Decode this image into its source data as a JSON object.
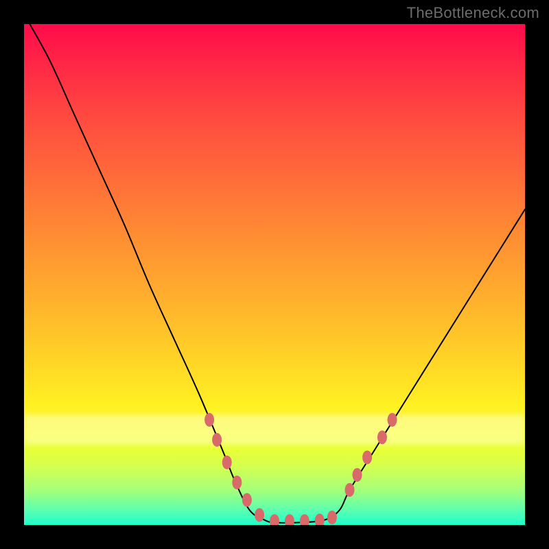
{
  "attribution": "TheBottleneck.com",
  "chart_data": {
    "type": "line",
    "title": "",
    "xlabel": "",
    "ylabel": "",
    "xlim": [
      0,
      100
    ],
    "ylim": [
      0,
      100
    ],
    "series": [
      {
        "name": "curve",
        "x": [
          0,
          5,
          10,
          15,
          20,
          25,
          30,
          35,
          40,
          42,
          45,
          48,
          50,
          55,
          60,
          63,
          65,
          70,
          75,
          80,
          85,
          90,
          95,
          100
        ],
        "values": [
          102,
          93,
          82,
          71,
          60,
          48,
          37,
          26,
          14,
          9,
          3,
          1,
          0.5,
          0.5,
          1,
          3,
          7,
          15,
          23,
          31,
          39,
          47,
          55,
          63
        ]
      }
    ],
    "markers": [
      {
        "x": 37,
        "y": 21
      },
      {
        "x": 38.5,
        "y": 17
      },
      {
        "x": 40.5,
        "y": 12.5
      },
      {
        "x": 42.5,
        "y": 8.5
      },
      {
        "x": 44.5,
        "y": 5
      },
      {
        "x": 47,
        "y": 2
      },
      {
        "x": 50,
        "y": 0.8
      },
      {
        "x": 53,
        "y": 0.8
      },
      {
        "x": 56,
        "y": 0.8
      },
      {
        "x": 59,
        "y": 0.9
      },
      {
        "x": 61.5,
        "y": 1.5
      },
      {
        "x": 65,
        "y": 7
      },
      {
        "x": 66.5,
        "y": 10
      },
      {
        "x": 68.5,
        "y": 13.5
      },
      {
        "x": 71.5,
        "y": 17.5
      },
      {
        "x": 73.5,
        "y": 21
      }
    ],
    "marker_color": "#d86a6a"
  }
}
